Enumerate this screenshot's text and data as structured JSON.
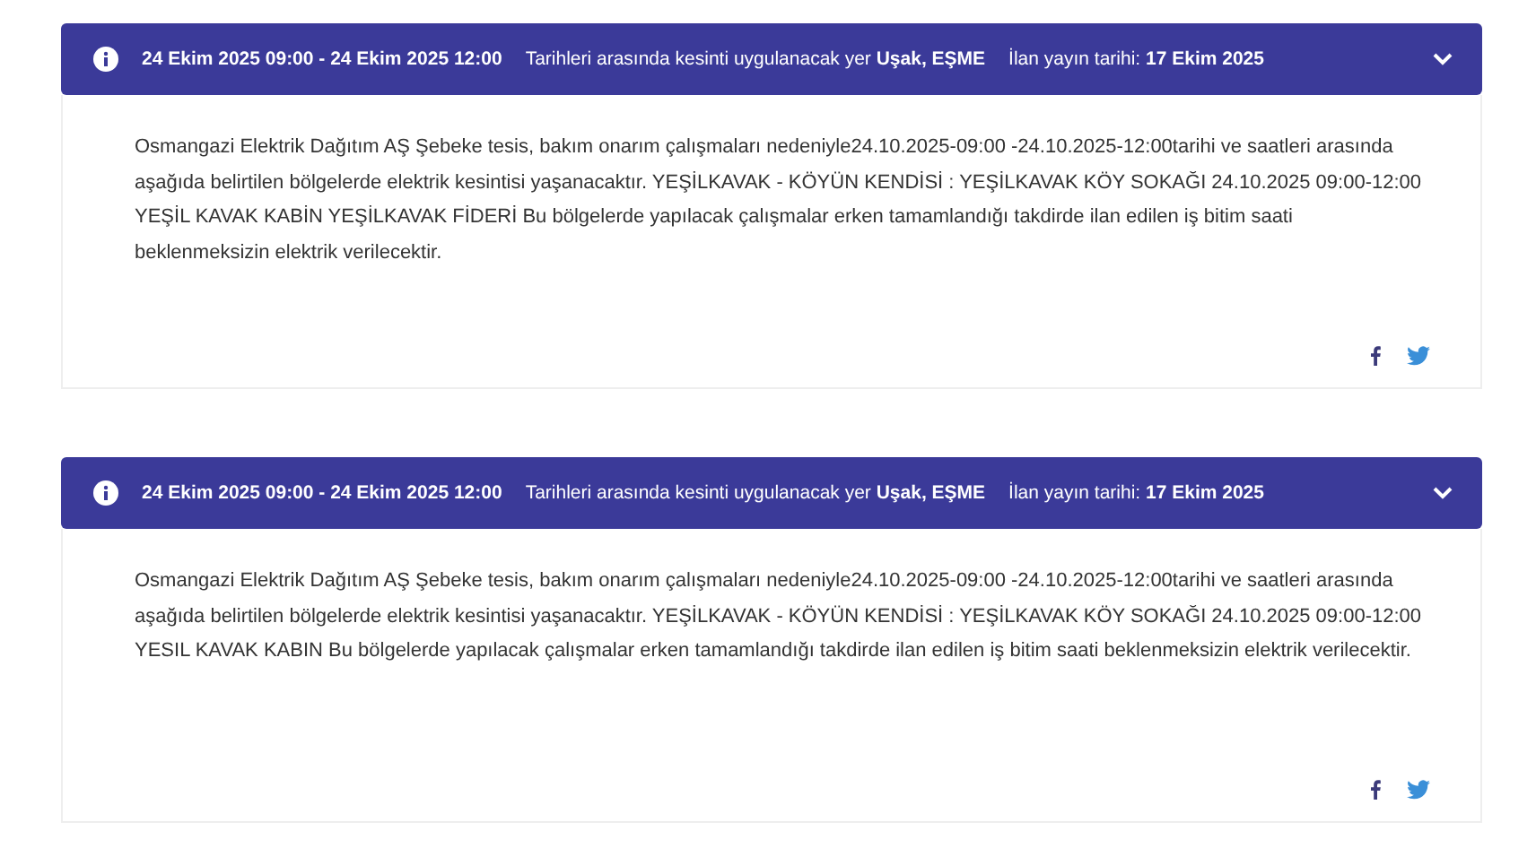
{
  "notices": [
    {
      "date_range": "24 Ekim 2025 09:00 - 24 Ekim 2025 12:00",
      "location_label": "Tarihleri arasında kesinti uygulanacak yer",
      "location": "Uşak, EŞME",
      "publish_label": "İlan yayın tarihi:",
      "publish_date": "17 Ekim 2025",
      "expanded": true,
      "body": "Osmangazi Elektrik Dağıtım AŞ Şebeke tesis, bakım onarım çalışmaları nedeniyle24.10.2025-09:00 -24.10.2025-12:00tarihi ve saatleri arasında aşağıda belirtilen bölgelerde elektrik kesintisi yaşanacaktır. YEŞİLKAVAK - KÖYÜN KENDİSİ : YEŞİLKAVAK KÖY SOKAĞI 24.10.2025 09:00-12:00 YEŞİL KAVAK KABİN YEŞİLKAVAK FİDERİ Bu bölgelerde yapılacak çalışmalar erken tamamlandığı takdirde ilan edilen iş bitim saati beklenmeksizin elektrik verilecektir."
    },
    {
      "date_range": "24 Ekim 2025 09:00 - 24 Ekim 2025 12:00",
      "location_label": "Tarihleri arasında kesinti uygulanacak yer",
      "location": "Uşak, EŞME",
      "publish_label": "İlan yayın tarihi:",
      "publish_date": "17 Ekim 2025",
      "expanded": true,
      "body": "Osmangazi Elektrik Dağıtım AŞ Şebeke tesis, bakım onarım çalışmaları nedeniyle24.10.2025-09:00 -24.10.2025-12:00tarihi ve saatleri arasında aşağıda belirtilen bölgelerde elektrik kesintisi yaşanacaktır. YEŞİLKAVAK - KÖYÜN KENDİSİ : YEŞİLKAVAK KÖY SOKAĞI 24.10.2025 09:00-12:00 YESIL KAVAK KABIN Bu bölgelerde yapılacak çalışmalar erken tamamlandığı takdirde ilan edilen iş bitim saati beklenmeksizin elektrik verilecektir."
    }
  ]
}
